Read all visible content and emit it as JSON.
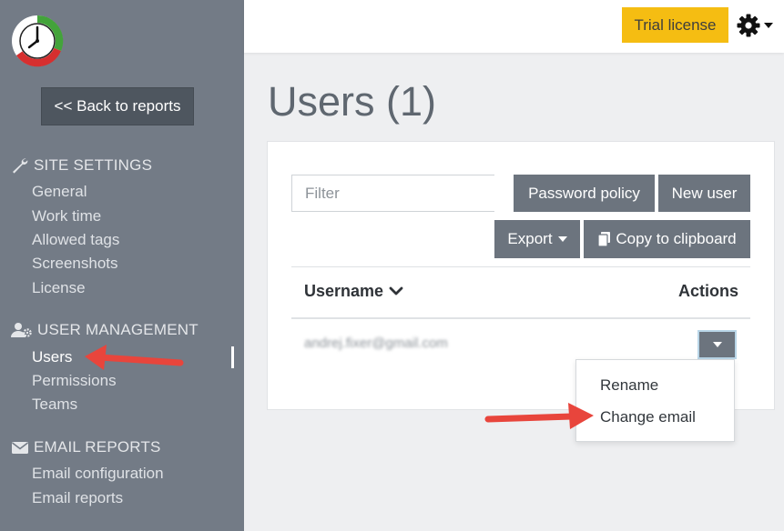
{
  "sidebar": {
    "back_label": "<< Back to reports",
    "sections": [
      {
        "title": "SITE SETTINGS",
        "icon": "wrench-icon",
        "items": [
          "General",
          "Work time",
          "Allowed tags",
          "Screenshots",
          "License"
        ]
      },
      {
        "title": "USER MANAGEMENT",
        "icon": "user-gear-icon",
        "items": [
          "Users",
          "Permissions",
          "Teams"
        ]
      },
      {
        "title": "EMAIL REPORTS",
        "icon": "envelope-icon",
        "items": [
          "Email configuration",
          "Email reports"
        ]
      }
    ],
    "active_item": "Users"
  },
  "topbar": {
    "trial_label": "Trial license",
    "settings_icon": "gear-icon"
  },
  "main": {
    "title": "Users (1)",
    "filter_placeholder": "Filter",
    "buttons": {
      "password_policy": "Password policy",
      "new_user": "New user",
      "export": "Export",
      "copy": "Copy to clipboard"
    },
    "table": {
      "col_username": "Username",
      "col_actions": "Actions",
      "rows": [
        {
          "username": "andrej.fixer@gmail.com"
        }
      ]
    },
    "actions_menu": [
      "Rename",
      "Change email"
    ]
  },
  "colors": {
    "sidebar_bg": "#737b86",
    "trial_bg": "#f5bd12",
    "button_bg": "#6c747e",
    "arrow": "#e8453c"
  }
}
